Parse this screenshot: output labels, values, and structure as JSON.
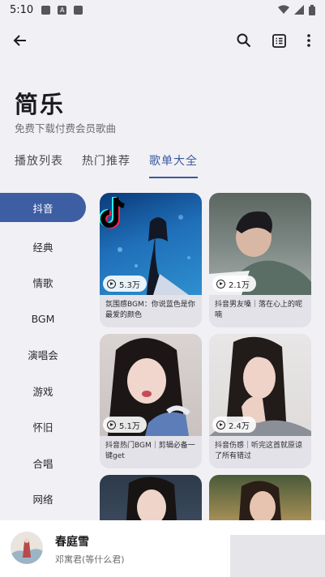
{
  "status": {
    "time": "5:10",
    "notif_a": "A"
  },
  "header": {
    "title": "简乐",
    "subtitle": "免费下载付费会员歌曲"
  },
  "tabs": [
    {
      "label": "播放列表"
    },
    {
      "label": "热门推荐"
    },
    {
      "label": "歌单大全"
    }
  ],
  "categories": [
    "抖音",
    "经典",
    "情歌",
    "BGM",
    "演唱会",
    "游戏",
    "怀旧",
    "合唱",
    "网络"
  ],
  "playlists": [
    {
      "count": "5.3万",
      "title": "氛围感BGM：你说蓝色是你最爱的颜色"
    },
    {
      "count": "2.1万",
      "title": "抖音男友嗓｜落在心上的呢喃"
    },
    {
      "count": "5.1万",
      "title": "抖音热门BGM｜剪辑必备一键get"
    },
    {
      "count": "2.4万",
      "title": "抖音伤感｜听完这首就原谅了所有错过"
    }
  ],
  "player": {
    "title": "春庭雪",
    "artist": "邓寓君(等什么君)"
  },
  "colors": {
    "accent": "#3d5ea3",
    "background": "#f1f0f4"
  }
}
